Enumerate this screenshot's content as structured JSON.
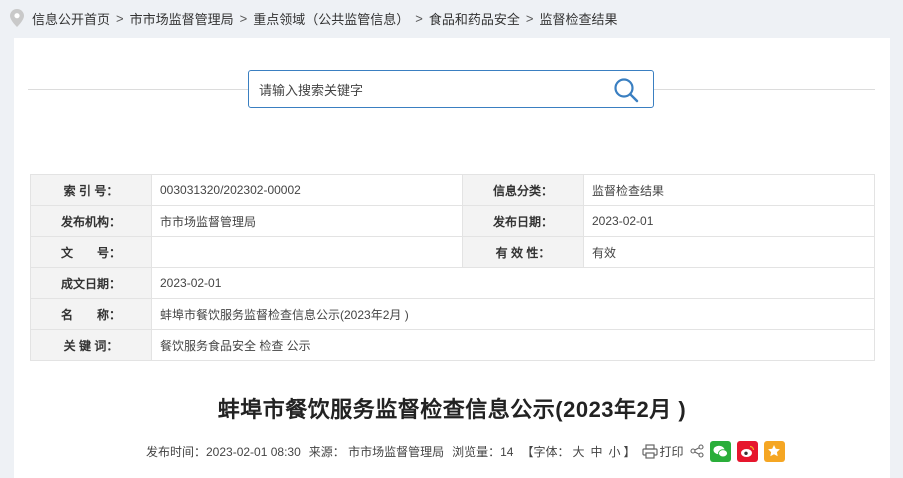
{
  "breadcrumb": {
    "items": [
      "信息公开首页",
      "市市场监督管理局",
      "重点领域（公共监管信息）",
      "食品和药品安全",
      "监督检查结果"
    ],
    "separator": ">"
  },
  "search": {
    "placeholder": "请输入搜索关键字"
  },
  "meta": {
    "index_label": "索 引 号：",
    "index_value": "003031320/202302-00002",
    "category_label": "信息分类：",
    "category_value": "监督检查结果",
    "publisher_label": "发布机构：",
    "publisher_value": "市市场监督管理局",
    "pubdate_label": "发布日期：",
    "pubdate_value": "2023-02-01",
    "docno_label": "文　　号：",
    "docno_value": "",
    "validity_label": "有 效 性：",
    "validity_value": "有效",
    "created_label": "成文日期：",
    "created_value": "2023-02-01",
    "name_label": "名　　称：",
    "name_value": "蚌埠市餐饮服务监督检查信息公示(2023年2月 )",
    "keywords_label": "关 键 词：",
    "keywords_value": "餐饮服务食品安全 检查 公示"
  },
  "article": {
    "title": "蚌埠市餐饮服务监督检查信息公示(2023年2月 )",
    "publish_time": "发布时间：2023-02-01 08:30",
    "source": "来源：  市市场监督管理局",
    "views": "浏览量：14",
    "font_prefix": "【字体：",
    "font_large": "大",
    "font_medium": "中",
    "font_small": "小",
    "font_suffix": "】",
    "print_label": "打印"
  },
  "colors": {
    "accent": "#3a7fc1",
    "wechat": "#2aae3a",
    "weibo": "#e6162d",
    "favorite": "#f5a623"
  },
  "icons": [
    "location-pin-icon",
    "search-icon",
    "print-icon",
    "share-icon",
    "wechat-icon",
    "weibo-icon",
    "favorite-icon"
  ]
}
